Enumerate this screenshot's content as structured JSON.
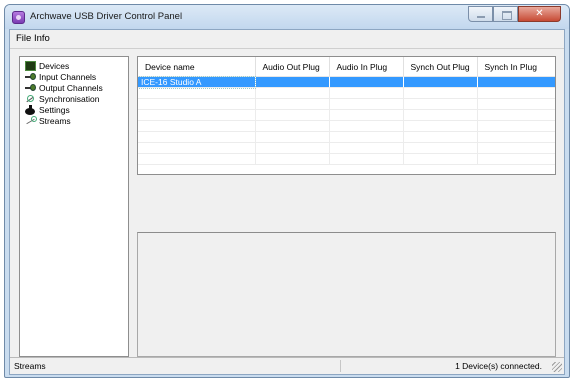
{
  "window": {
    "title": "Archwave USB Driver Control Panel"
  },
  "menu": {
    "file": "File",
    "info": "Info"
  },
  "tree": {
    "items": [
      {
        "label": "Devices",
        "icon": "devices-icon"
      },
      {
        "label": "Input Channels",
        "icon": "input-channels-icon"
      },
      {
        "label": "Output Channels",
        "icon": "output-channels-icon"
      },
      {
        "label": "Synchronisation",
        "icon": "synchronisation-icon"
      },
      {
        "label": "Settings",
        "icon": "settings-icon"
      },
      {
        "label": "Streams",
        "icon": "streams-icon"
      }
    ]
  },
  "table": {
    "columns": [
      "Device name",
      "Audio Out Plug",
      "Audio In Plug",
      "Synch Out Plug",
      "Synch In Plug"
    ],
    "rows": [
      [
        "ICE-16 Studio A",
        "",
        "",
        "",
        ""
      ]
    ]
  },
  "status": {
    "left": "Streams",
    "right": "1 Device(s) connected."
  },
  "colors": {
    "selection": "#3399ff",
    "titlebar": "#c9dcef",
    "close": "#c74a34"
  }
}
